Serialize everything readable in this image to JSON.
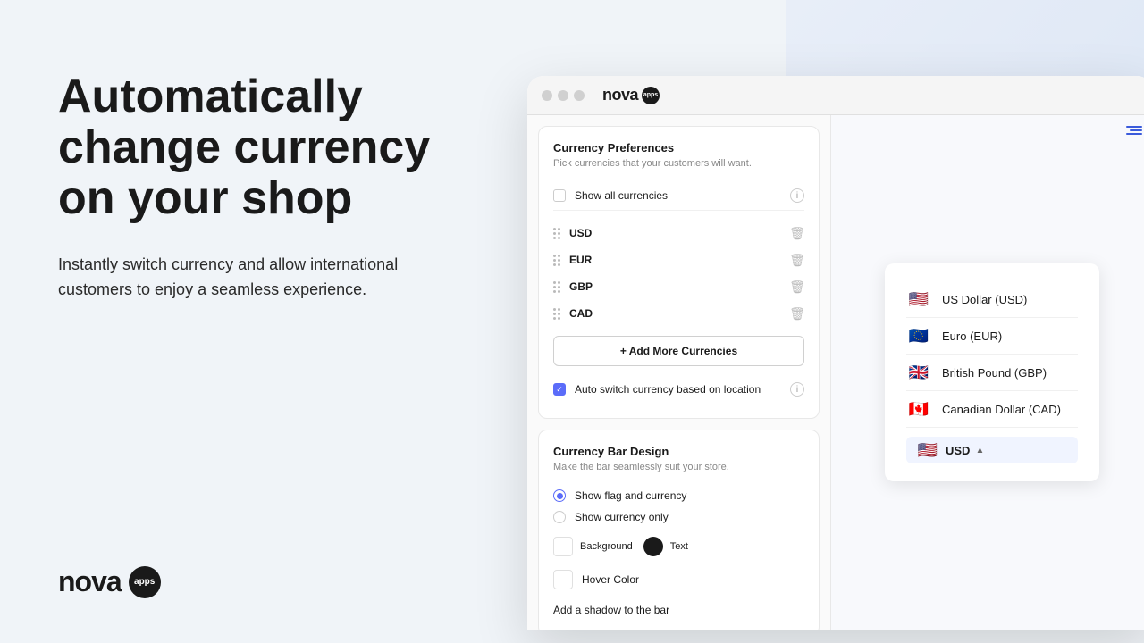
{
  "background": {
    "color": "#f0f4f8"
  },
  "left_panel": {
    "hero_title": "Automatically change currency on your shop",
    "hero_subtitle": "Instantly switch currency and allow international customers to enjoy a seamless experience.",
    "logo_text": "nova",
    "logo_badge": "apps"
  },
  "browser": {
    "dots": [
      "dot1",
      "dot2",
      "dot3"
    ],
    "logo_text": "nova",
    "logo_badge": "apps"
  },
  "settings": {
    "section1": {
      "title": "Currency Preferences",
      "subtitle": "Pick currencies that your customers will want.",
      "show_all_label": "Show all currencies",
      "currencies": [
        "USD",
        "EUR",
        "GBP",
        "CAD"
      ],
      "add_button": "+ Add More Currencies",
      "auto_switch_label": "Auto switch currency based on location"
    },
    "section2": {
      "title": "Currency Bar Design",
      "subtitle": "Make the bar seamlessly suit your store.",
      "options": [
        {
          "label": "Show flag and currency",
          "checked": true
        },
        {
          "label": "Show currency only",
          "checked": false
        }
      ],
      "background_label": "Background",
      "text_label": "Text",
      "hover_label": "Hover Color",
      "shadow_label": "Add a shadow to the bar"
    }
  },
  "preview": {
    "currencies": [
      {
        "flag": "🇺🇸",
        "name": "US Dollar (USD)"
      },
      {
        "flag": "🇪🇺",
        "name": "Euro (EUR)"
      },
      {
        "flag": "🇬🇧",
        "name": "British Pound (GBP)"
      },
      {
        "flag": "🇨🇦",
        "name": "Canadian Dollar (CAD)"
      }
    ],
    "selected": "USD"
  }
}
